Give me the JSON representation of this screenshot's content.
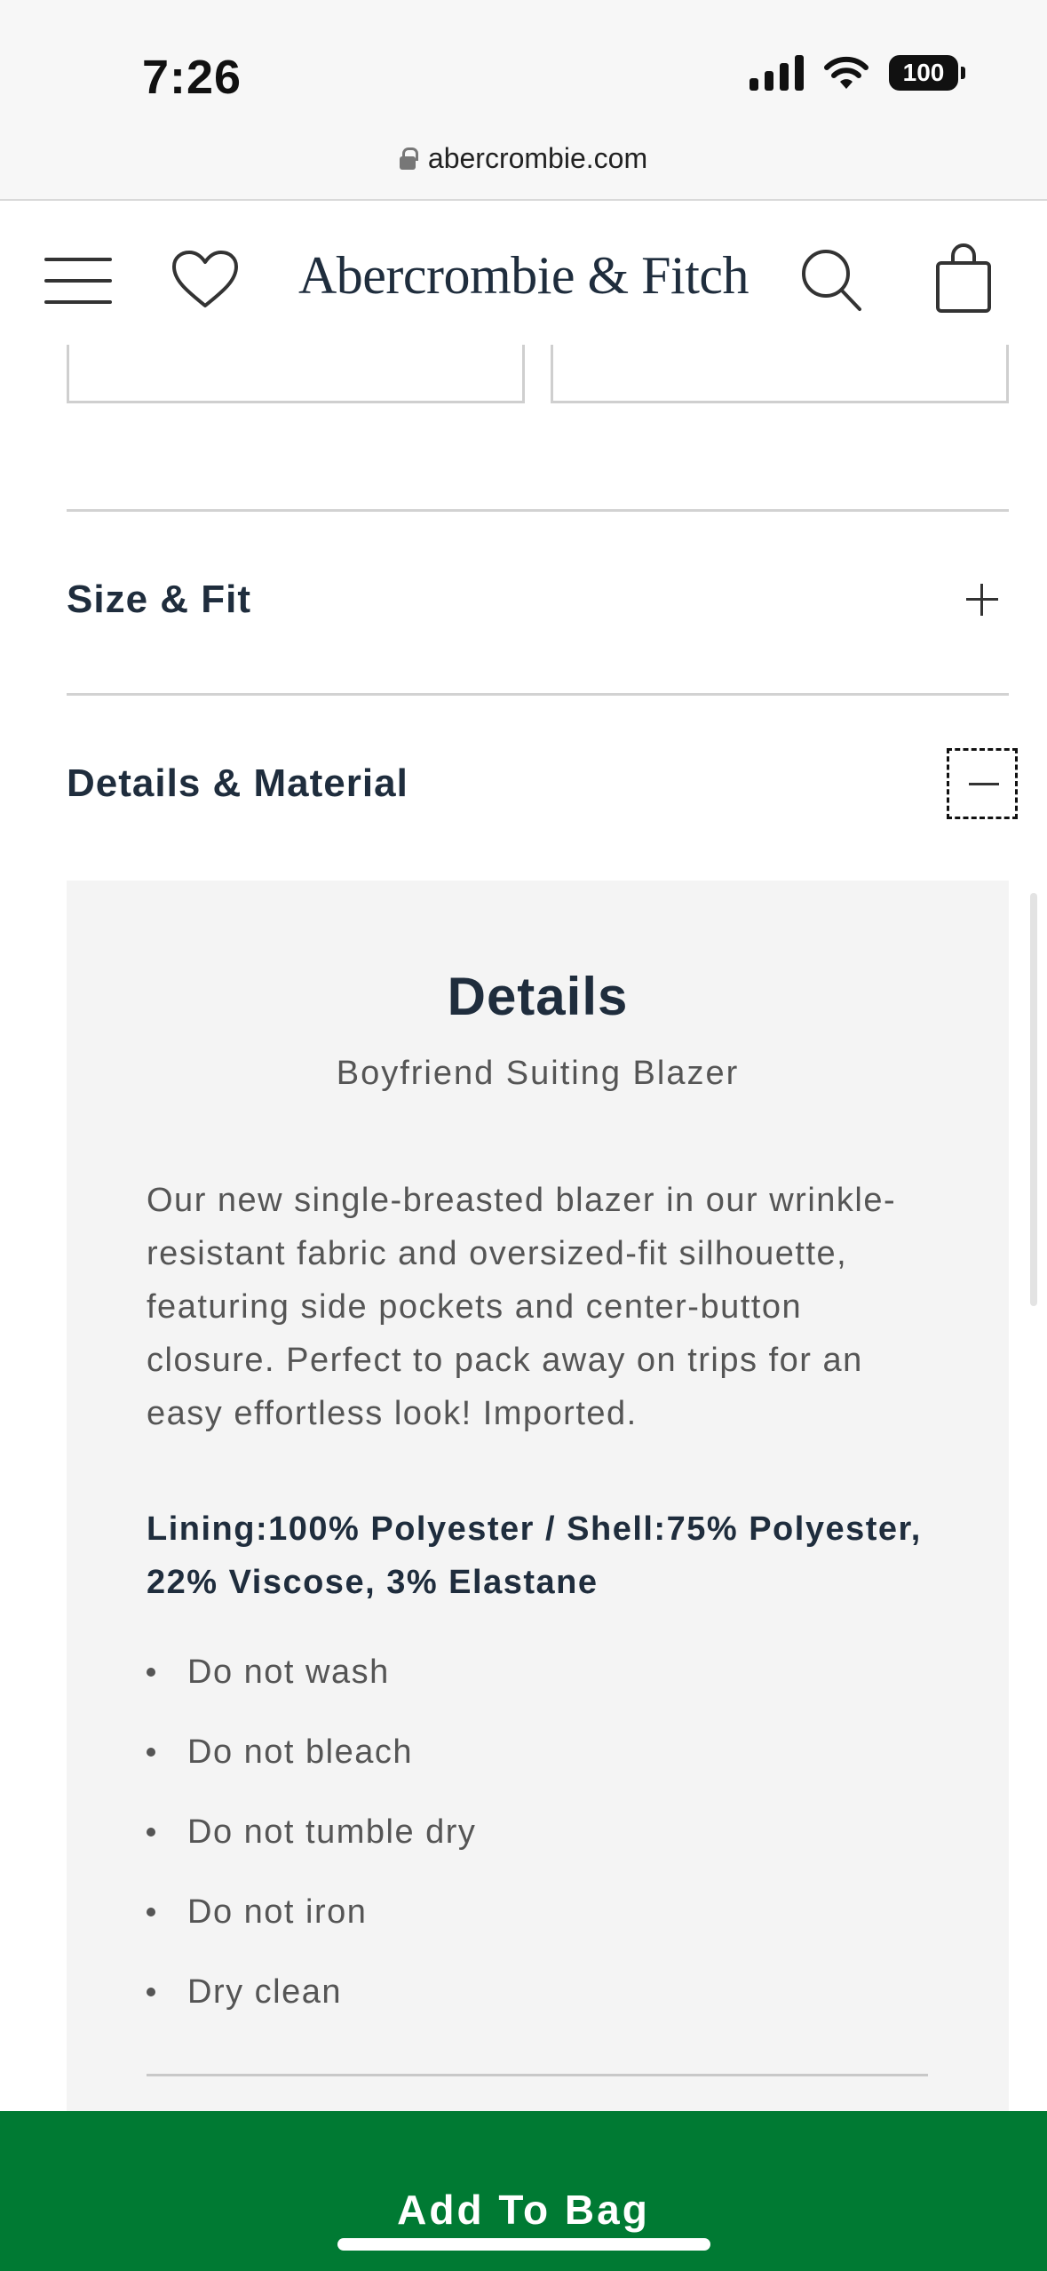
{
  "status_bar": {
    "time": "7:26",
    "battery": "100"
  },
  "browser": {
    "url": "abercrombie.com"
  },
  "header": {
    "logo": "Abercrombie & Fitch",
    "icons": [
      "menu-icon",
      "heart-icon",
      "search-icon",
      "shopping-bag-icon"
    ]
  },
  "accordion": {
    "size_fit": {
      "title": "Size & Fit",
      "state": "collapsed"
    },
    "details_material": {
      "title": "Details & Material",
      "state": "expanded"
    }
  },
  "details": {
    "heading": "Details",
    "product_name": "Boyfriend Suiting Blazer",
    "description": "Our new single-breasted blazer in our wrinkle-resistant fabric and oversized-fit silhouette, featuring side pockets and center-button closure. Perfect to pack away on trips for an easy effortless look! Imported.",
    "material_line1": "Lining:100% Polyester / Shell:75% Polyester,",
    "material_line2": "22% Viscose, 3% Elastane",
    "care": [
      "Do not wash",
      "Do not bleach",
      "Do not tumble dry",
      "Do not iron",
      "Dry clean"
    ]
  },
  "cta": {
    "add_to_bag": "Add To Bag",
    "color": "#007a33"
  }
}
